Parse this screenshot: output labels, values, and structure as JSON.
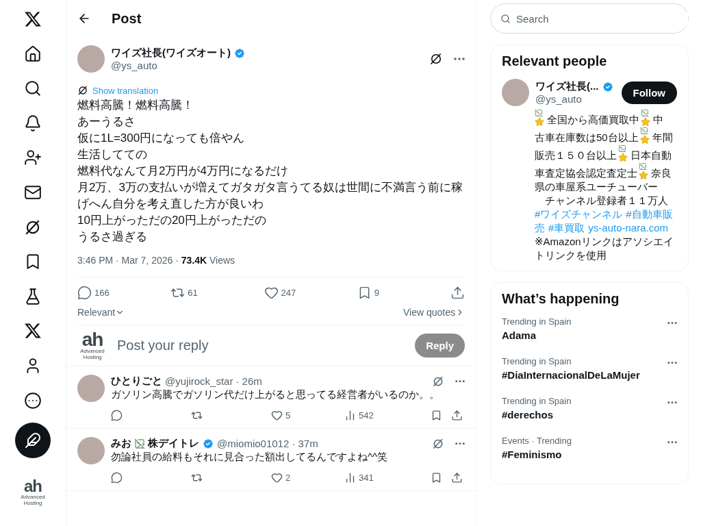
{
  "nav": {
    "items": [
      {
        "kind": "logo",
        "selected": false
      },
      {
        "kind": "home",
        "selected": false
      },
      {
        "kind": "search",
        "selected": false
      },
      {
        "kind": "bell",
        "selected": false
      },
      {
        "kind": "people",
        "selected": false
      },
      {
        "kind": "mail",
        "selected": false
      },
      {
        "kind": "grok",
        "selected": false
      },
      {
        "kind": "bookmark",
        "selected": false
      },
      {
        "kind": "flask",
        "selected": false
      },
      {
        "kind": "logo",
        "selected": false
      },
      {
        "kind": "profile",
        "selected": false
      },
      {
        "kind": "more",
        "selected": false
      }
    ],
    "account": {
      "logo": "ah",
      "logo_caption": "Advanced Hosting"
    }
  },
  "header": {
    "title": "Post"
  },
  "post": {
    "name": "ワイズ社長(ワイズオート)",
    "verified": true,
    "handle": "@ys_auto",
    "translate": "Show translation",
    "lines": [
      "燃料高騰！燃料高騰！",
      "あーうるさ",
      "仮に1L=300円になっても倍やん",
      "生活してての",
      "燃料代なんて月2万円が4万円になるだけ",
      "月2万、3万の支払いが増えてガタガタ言うてる奴は世間に不満言う前に稼げへん自分を考え直した方が良いわ",
      "10円上がっただの20円上がっただの",
      "うるさ過ぎる"
    ],
    "time": "3:46 PM · Mar 7, 2026 · ",
    "views_count": "73.4K",
    "views_label": " Views",
    "stats": [
      {
        "kind": "reply",
        "count": "166"
      },
      {
        "kind": "repost",
        "count": "61"
      },
      {
        "kind": "like",
        "count": "247"
      },
      {
        "kind": "bookmark",
        "count": "9"
      },
      {
        "kind": "share"
      }
    ],
    "sort": "Relevant",
    "quotes": "View quotes"
  },
  "composer": {
    "logo": "ah",
    "logo_caption": "Advanced Hosting",
    "placeholder": "Post your reply",
    "button": "Reply",
    "disabled": true
  },
  "replies": [
    {
      "name_parts": [
        {
          "kind": "text",
          "text": "ひとりごと"
        }
      ],
      "handle": "@yujirock_star",
      "time": "· 26m",
      "text": "ガソリン高騰でガソリン代だけ上がると思ってる経営者がいるのか。。",
      "likes": "5",
      "views": "542"
    },
    {
      "name_parts": [
        {
          "kind": "text",
          "text": "みお"
        },
        {
          "kind": "image"
        },
        {
          "kind": "text",
          "text": "株デイトレ"
        }
      ],
      "verified": true,
      "handle": "@miomio01012",
      "time": "· 37m",
      "text": "勿論社員の給料もそれに見合った額出してるんですよね^^笑",
      "likes": "2",
      "views": "341"
    }
  ],
  "search": {
    "placeholder": "Search"
  },
  "relevant": {
    "title": "Relevant people",
    "name": "ワイズ社長(...",
    "verified": true,
    "handle": "@ys_auto",
    "follow": "Follow",
    "bio_lines": [
      [
        {
          "kind": "emoji"
        },
        {
          "kind": "text",
          "text": "全国から高価買取中"
        },
        {
          "kind": "emoji"
        },
        {
          "kind": "text",
          "text": "中"
        }
      ],
      [
        {
          "kind": "text",
          "text": "古車在庫数は50台以上"
        },
        {
          "kind": "emoji"
        },
        {
          "kind": "text",
          "text": "年間"
        }
      ],
      [
        {
          "kind": "text",
          "text": "販売１５０台以上"
        },
        {
          "kind": "emoji"
        },
        {
          "kind": "text",
          "text": "日本自動"
        }
      ],
      [
        {
          "kind": "text",
          "text": "車査定協会認定査定士"
        },
        {
          "kind": "emoji"
        },
        {
          "kind": "text",
          "text": "奈良"
        }
      ],
      [
        {
          "kind": "text",
          "text": "県の車屋系ユーチューバー"
        }
      ],
      [
        {
          "kind": "text",
          "text": "　チャンネル登録者１１万人"
        }
      ],
      [
        {
          "kind": "link",
          "text": "#ワイズチャンネル"
        },
        {
          "kind": "link",
          "text": "#自動車販"
        }
      ],
      [
        {
          "kind": "link",
          "text": "売"
        },
        {
          "kind": "link",
          "text": "#車買取"
        },
        {
          "kind": "link",
          "text": "ys-auto-nara.com"
        }
      ],
      [
        {
          "kind": "text",
          "text": "※Amazonリンクはアソシエイ"
        }
      ],
      [
        {
          "kind": "text",
          "text": "トリンクを使用"
        }
      ]
    ]
  },
  "trends": {
    "title": "What’s happening",
    "items": [
      {
        "context": "Trending in Spain",
        "topic": "Adama"
      },
      {
        "context": "Trending in Spain",
        "topic": "#DiaInternacionalDeLaMujer"
      },
      {
        "context": "Trending in Spain",
        "topic": "#derechos"
      },
      {
        "context": "Events · Trending",
        "topic": "#Feminismo"
      }
    ]
  }
}
